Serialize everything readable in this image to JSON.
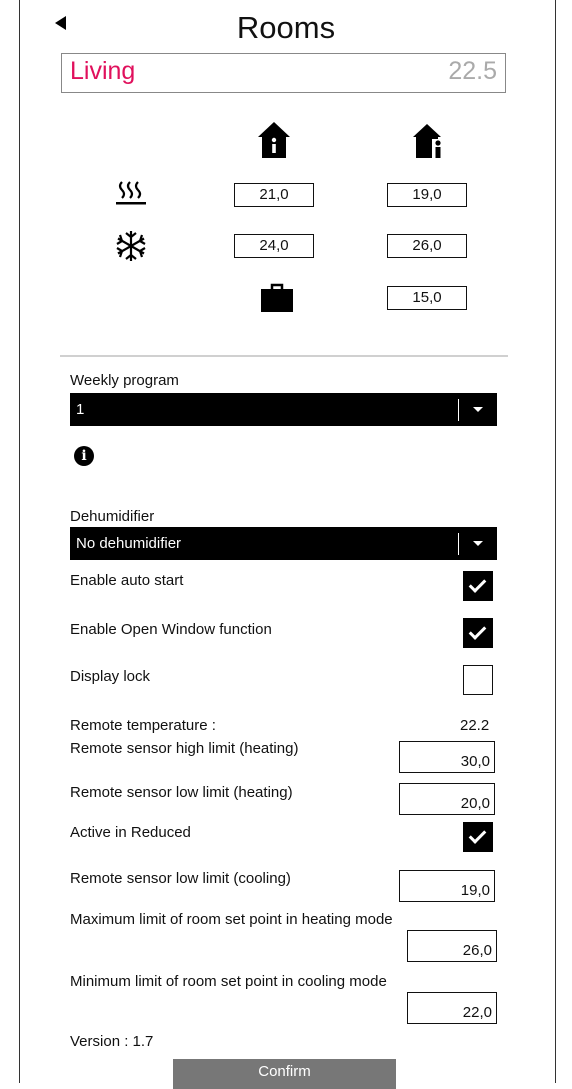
{
  "header": {
    "title": "Rooms"
  },
  "room": {
    "name": "Living",
    "temperature": "22.5"
  },
  "setpoints": {
    "heating": {
      "comfort": "21,0",
      "reduced": "19,0"
    },
    "cooling": {
      "comfort": "24,0",
      "reduced": "26,0"
    },
    "away": "15,0"
  },
  "weekly_program": {
    "label": "Weekly program",
    "value": "1"
  },
  "dehumidifier": {
    "label": "Dehumidifier",
    "value": "No dehumidifier"
  },
  "settings": {
    "enable_auto_start": {
      "label": "Enable auto start",
      "checked": true
    },
    "enable_open_window": {
      "label": "Enable Open Window function",
      "checked": true
    },
    "display_lock": {
      "label": "Display lock",
      "checked": false
    },
    "remote_temperature": {
      "label": "Remote temperature :",
      "value": "22.2"
    },
    "remote_high_heating": {
      "label": "Remote sensor high limit (heating)",
      "value": "30,0"
    },
    "remote_low_heating": {
      "label": "Remote sensor low limit (heating)",
      "value": "20,0"
    },
    "active_in_reduced": {
      "label": "Active in Reduced",
      "checked": true
    },
    "remote_low_cooling": {
      "label": "Remote sensor low limit (cooling)",
      "value": "19,0"
    },
    "max_heating_setpoint": {
      "label": "Maximum limit of room set point in heating mode",
      "value": "26,0"
    },
    "min_cooling_setpoint": {
      "label": "Minimum limit of room set point in cooling mode",
      "value": "22,0"
    }
  },
  "version": "Version : 1.7",
  "confirm_label": "Confirm",
  "colors": {
    "room_name": "#e0105c",
    "room_temp": "#aaaaaa",
    "confirm_bg": "#777777"
  },
  "icons": {
    "comfort": "home-info-icon",
    "reduced": "home-person-icon",
    "heating": "heating-waves-icon",
    "cooling": "snowflake-icon",
    "away": "briefcase-icon",
    "info": "info-icon"
  }
}
